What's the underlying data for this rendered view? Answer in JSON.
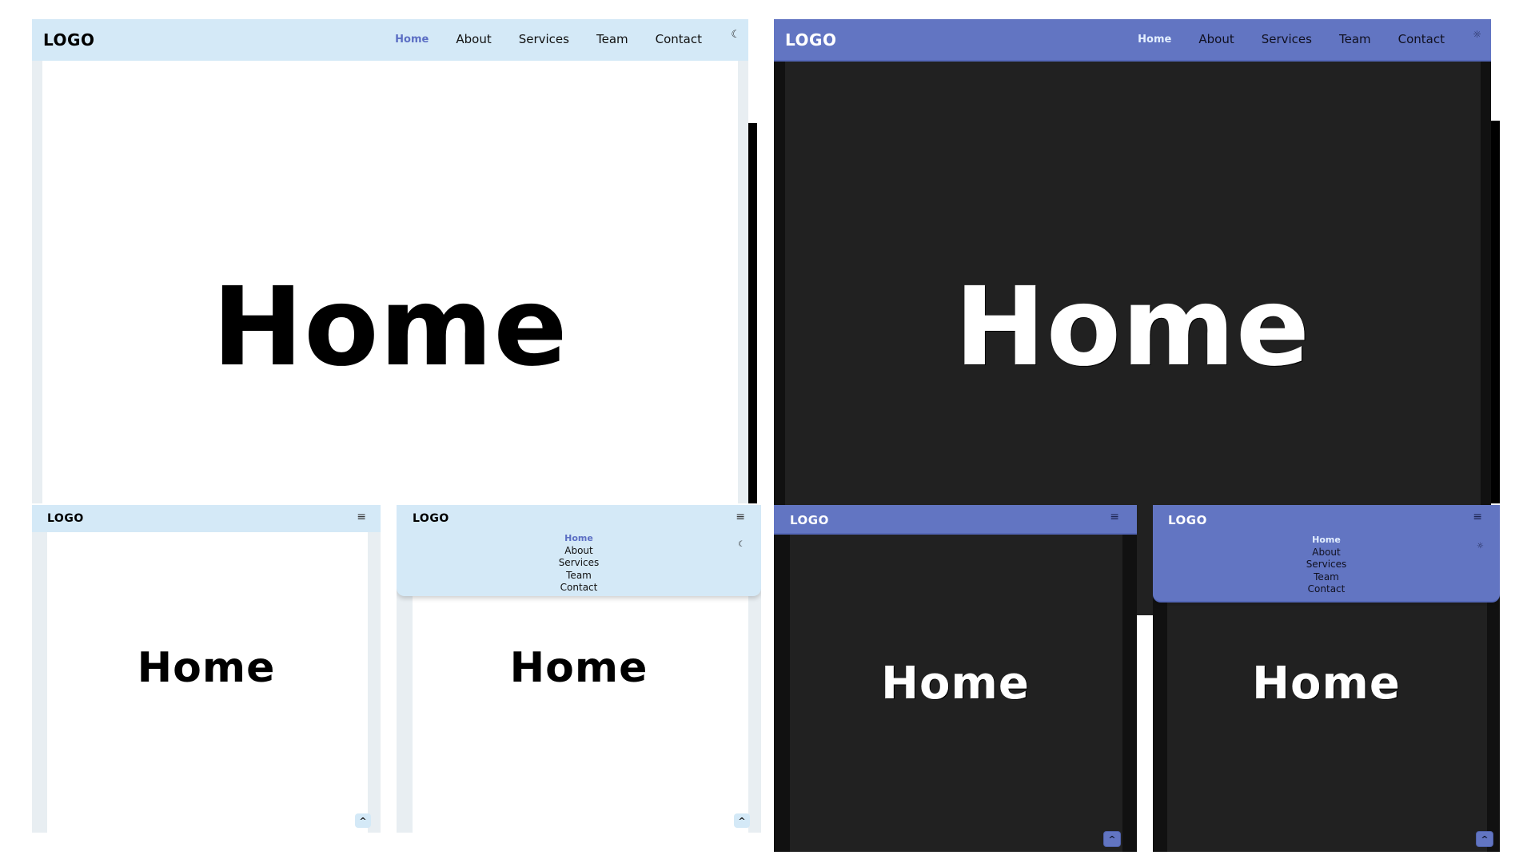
{
  "brand": {
    "logo": "LOGO"
  },
  "nav": {
    "items": [
      {
        "label": "Home",
        "active": true
      },
      {
        "label": "About",
        "active": false
      },
      {
        "label": "Services",
        "active": false
      },
      {
        "label": "Team",
        "active": false
      },
      {
        "label": "Contact",
        "active": false
      }
    ]
  },
  "hero": {
    "title": "Home"
  },
  "icons": {
    "moon": "☾",
    "sun": "☼",
    "menu": "≡",
    "scroll_top": "^"
  },
  "theme": {
    "light_header_bg": "#d4e9f7",
    "dark_header_bg": "#6275c2",
    "accent": "#5c6fc4",
    "dark_body_bg": "#212121"
  },
  "variants": [
    {
      "id": "light-desktop",
      "mode": "light",
      "layout": "desktop",
      "menu_open": false
    },
    {
      "id": "dark-desktop",
      "mode": "dark",
      "layout": "desktop",
      "menu_open": false
    },
    {
      "id": "light-mobile",
      "mode": "light",
      "layout": "mobile",
      "menu_open": false
    },
    {
      "id": "light-mobile-menu",
      "mode": "light",
      "layout": "mobile",
      "menu_open": true
    },
    {
      "id": "dark-mobile",
      "mode": "dark",
      "layout": "mobile",
      "menu_open": false
    },
    {
      "id": "dark-mobile-menu",
      "mode": "dark",
      "layout": "mobile",
      "menu_open": true
    }
  ]
}
